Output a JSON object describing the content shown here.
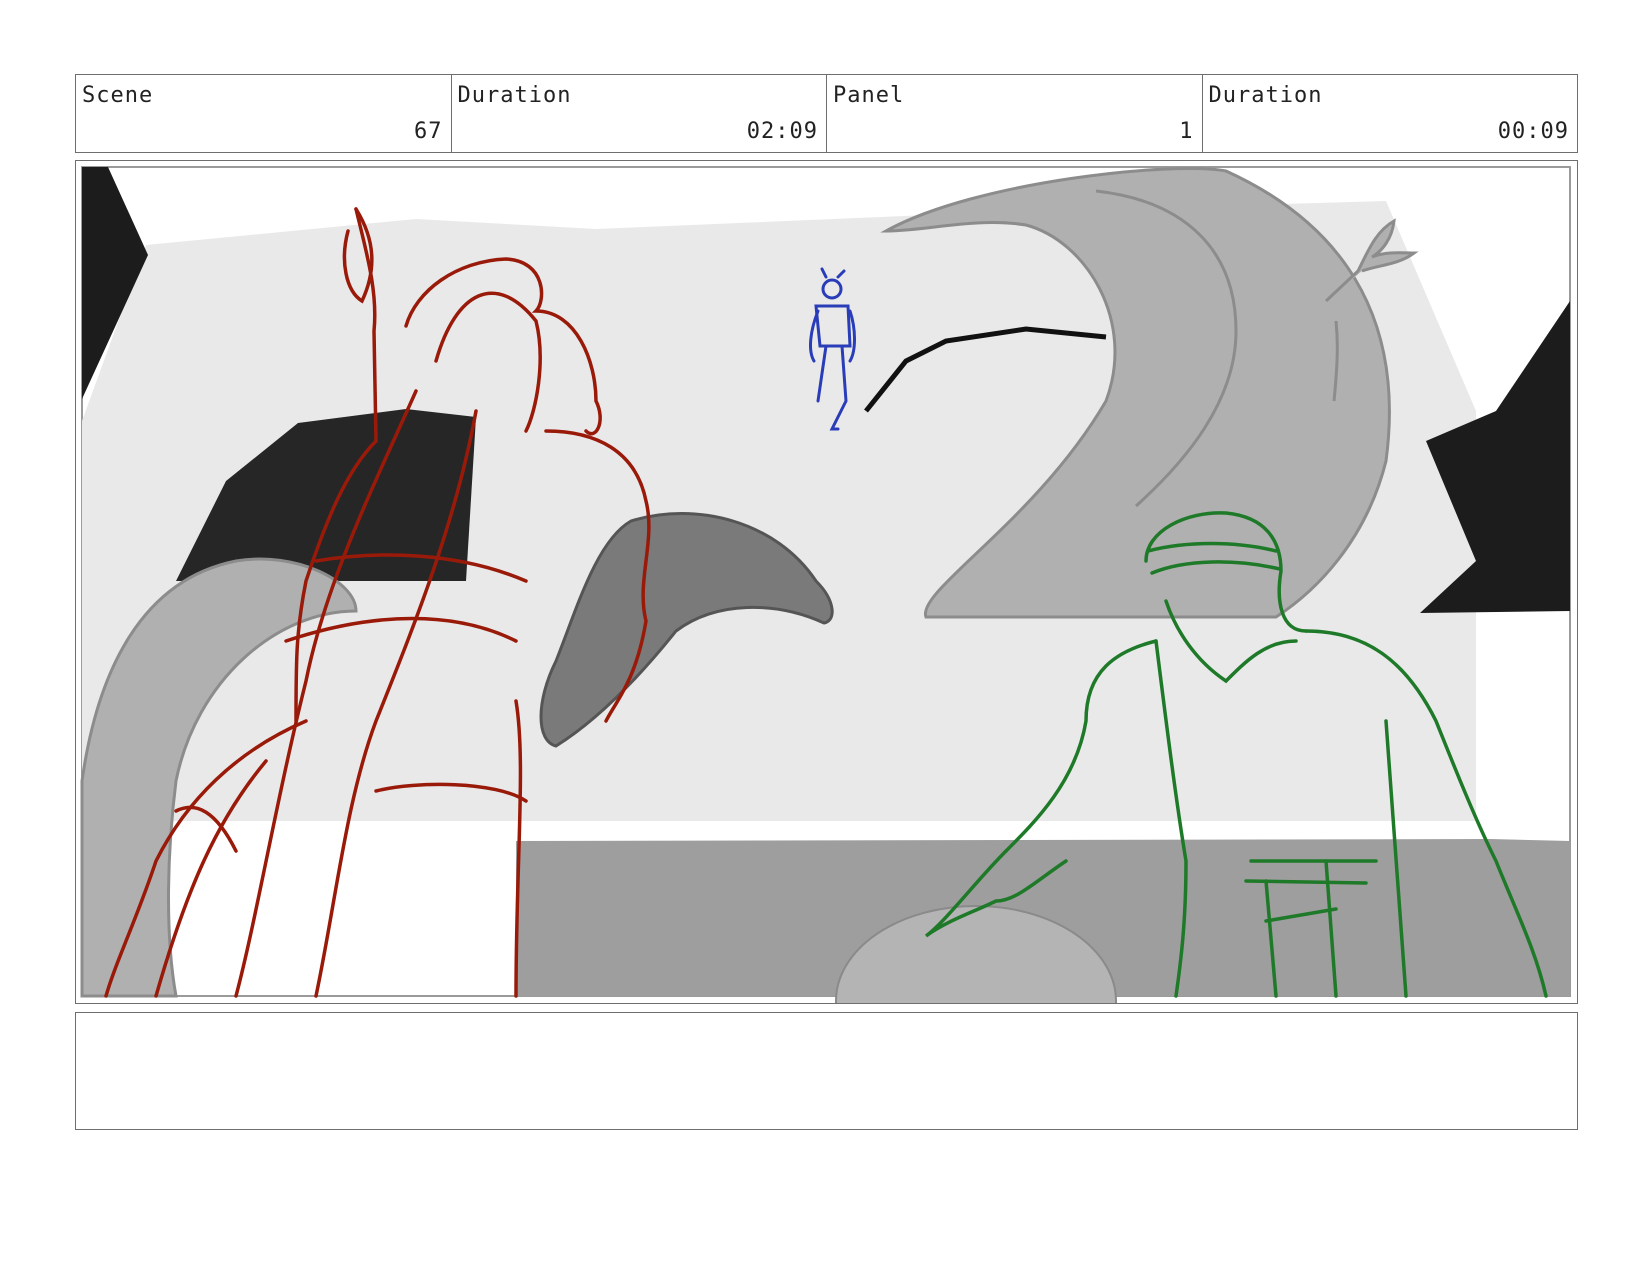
{
  "header": {
    "scene_label": "Scene",
    "scene_value": "67",
    "scene_duration_label": "Duration",
    "scene_duration_value": "02:09",
    "panel_label": "Panel",
    "panel_value": "1",
    "panel_duration_label": "Duration",
    "panel_duration_value": "00:09"
  },
  "notes": {
    "text": ""
  },
  "colors": {
    "frame_border": "#6e6e6e",
    "sketch_red": "#9a1a0a",
    "sketch_green": "#1e7a28",
    "sketch_blue": "#2a3db8",
    "tone_dark": "#1c1c1c",
    "tone_mid": "#a8a8a8",
    "tone_light": "#e9e9e9"
  }
}
